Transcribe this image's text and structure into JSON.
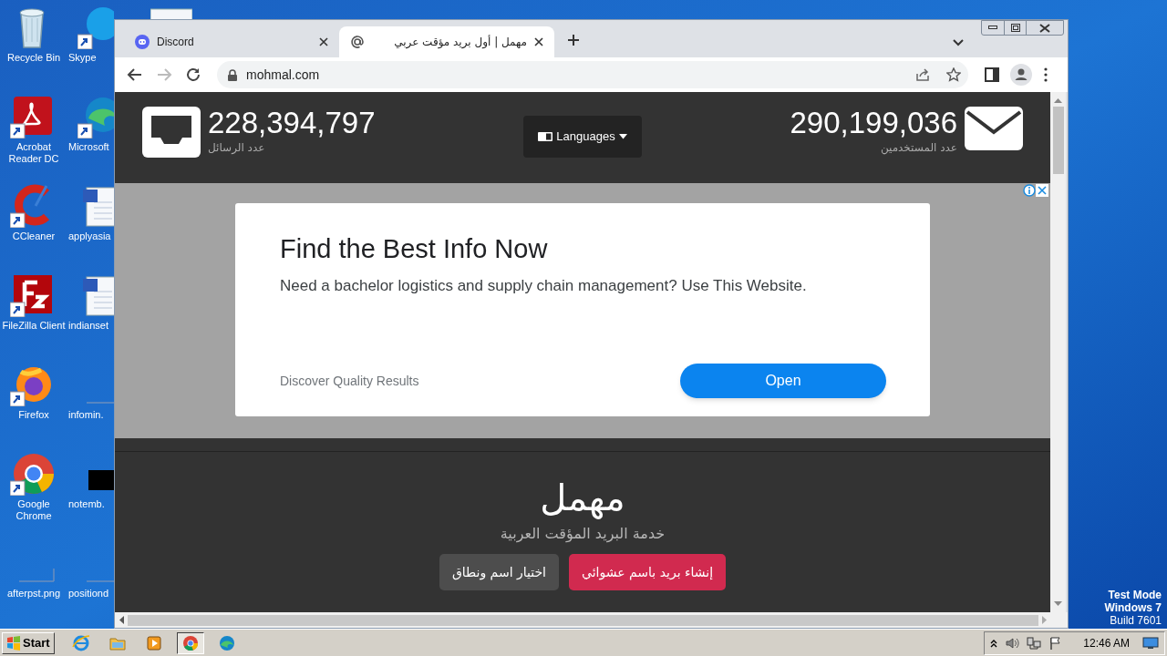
{
  "desktop": {
    "icons": [
      {
        "label": "Recycle Bin",
        "kind": "recycle"
      },
      {
        "label": "Skype",
        "kind": "skype"
      },
      {
        "label": "Acrobat Reader DC",
        "kind": "acrobat"
      },
      {
        "label": "Microsoft",
        "kind": "edge"
      },
      {
        "label": "CCleaner",
        "kind": "ccleaner"
      },
      {
        "label": "applyasia",
        "kind": "word"
      },
      {
        "label": "FileZilla Client",
        "kind": "filezilla"
      },
      {
        "label": "indianset",
        "kind": "word"
      },
      {
        "label": "Firefox",
        "kind": "firefox"
      },
      {
        "label": "infomin.",
        "kind": "blank"
      },
      {
        "label": "Google Chrome",
        "kind": "chrome"
      },
      {
        "label": "notemb.",
        "kind": "black"
      },
      {
        "label": "afterpst.png",
        "kind": "blank"
      },
      {
        "label": "positiond",
        "kind": "blank"
      }
    ],
    "notice": [
      "Test Mode",
      "Windows 7",
      "Build 7601"
    ]
  },
  "browser": {
    "tabs": [
      {
        "title": "Discord",
        "kind": "discord",
        "selected": false
      },
      {
        "title": "مهمل | أول بريد مؤقت عربي",
        "kind": "at",
        "selected": true
      }
    ],
    "url": "mohmal.com"
  },
  "page": {
    "messages_stat": {
      "count": "228,394,797",
      "label": "عدد الرسائل",
      "kind": "inbox"
    },
    "users_stat": {
      "count": "290,199,036",
      "label": "عدد المستخدمين",
      "kind": "mail"
    },
    "language_button": "Languages",
    "ad": {
      "title": "Find the Best Info Now",
      "body": "Need a bachelor logistics and supply chain management? Use This Website.",
      "footer": "Discover Quality Results",
      "button": "Open"
    },
    "logo": "مهمل",
    "tagline": "خدمة البريد المؤقت العربية",
    "buttons": [
      {
        "label": "إنشاء بريد باسم عشوائي",
        "kind": "primary"
      },
      {
        "label": "اختيار اسم ونطاق",
        "kind": "secondary"
      }
    ]
  },
  "taskbar": {
    "start": "Start",
    "apps": [
      {
        "kind": "ie",
        "selected": false
      },
      {
        "kind": "folder",
        "selected": false
      },
      {
        "kind": "media",
        "selected": false
      },
      {
        "kind": "chrome",
        "selected": true
      },
      {
        "kind": "edge",
        "selected": false
      }
    ],
    "clock": "12:46 AM"
  }
}
